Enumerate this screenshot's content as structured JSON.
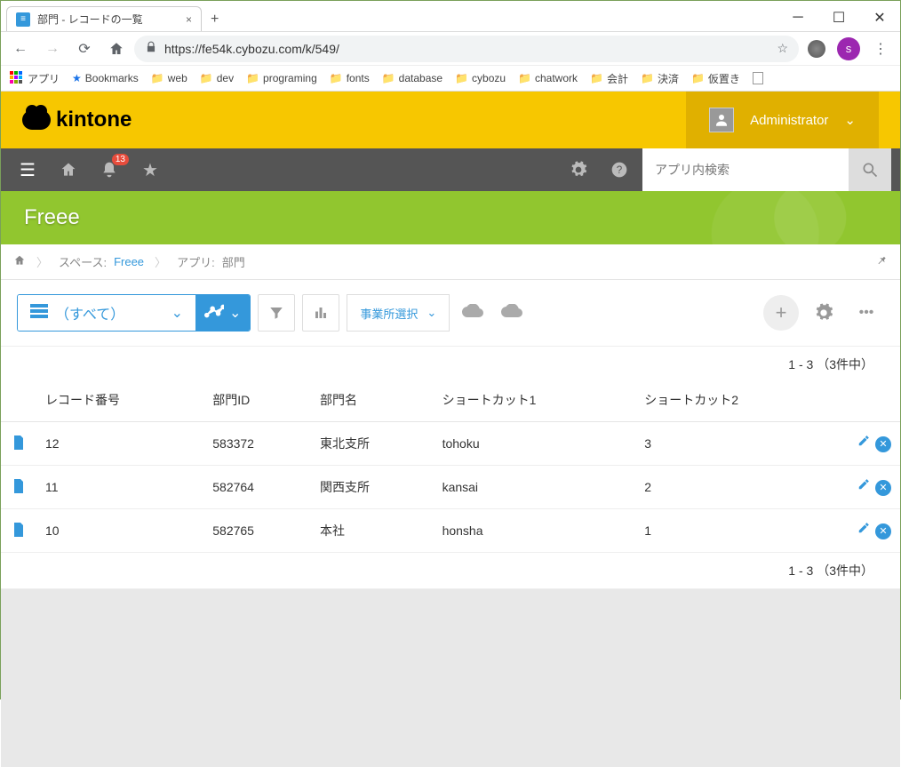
{
  "browser": {
    "tab_title": "部門 - レコードの一覧",
    "url": "https://fe54k.cybozu.com/k/549/",
    "bookmarks_label": "アプリ",
    "bookmarks": [
      "Bookmarks",
      "web",
      "dev",
      "programing",
      "fonts",
      "database",
      "cybozu",
      "chatwork",
      "会計",
      "決済",
      "仮置き"
    ],
    "avatar_letter": "s"
  },
  "header": {
    "brand": "kintone",
    "user": "Administrator",
    "notif_count": "13",
    "search_placeholder": "アプリ内検索"
  },
  "band": {
    "title": "Freee"
  },
  "crumb": {
    "space_label": "スペース:",
    "space_name": "Freee",
    "app_label": "アプリ:",
    "app_name": "部門"
  },
  "tools": {
    "view_name": "（すべて）",
    "biz_select": "事業所選択"
  },
  "count": "1 - 3 （3件中）",
  "table": {
    "headers": [
      "レコード番号",
      "部門ID",
      "部門名",
      "ショートカット1",
      "ショートカット2"
    ],
    "rows": [
      {
        "num": "12",
        "id": "583372",
        "name": "東北支所",
        "sc1": "tohoku",
        "sc2": "3"
      },
      {
        "num": "11",
        "id": "582764",
        "name": "関西支所",
        "sc1": "kansai",
        "sc2": "2"
      },
      {
        "num": "10",
        "id": "582765",
        "name": "本社",
        "sc1": "honsha",
        "sc2": "1"
      }
    ]
  }
}
